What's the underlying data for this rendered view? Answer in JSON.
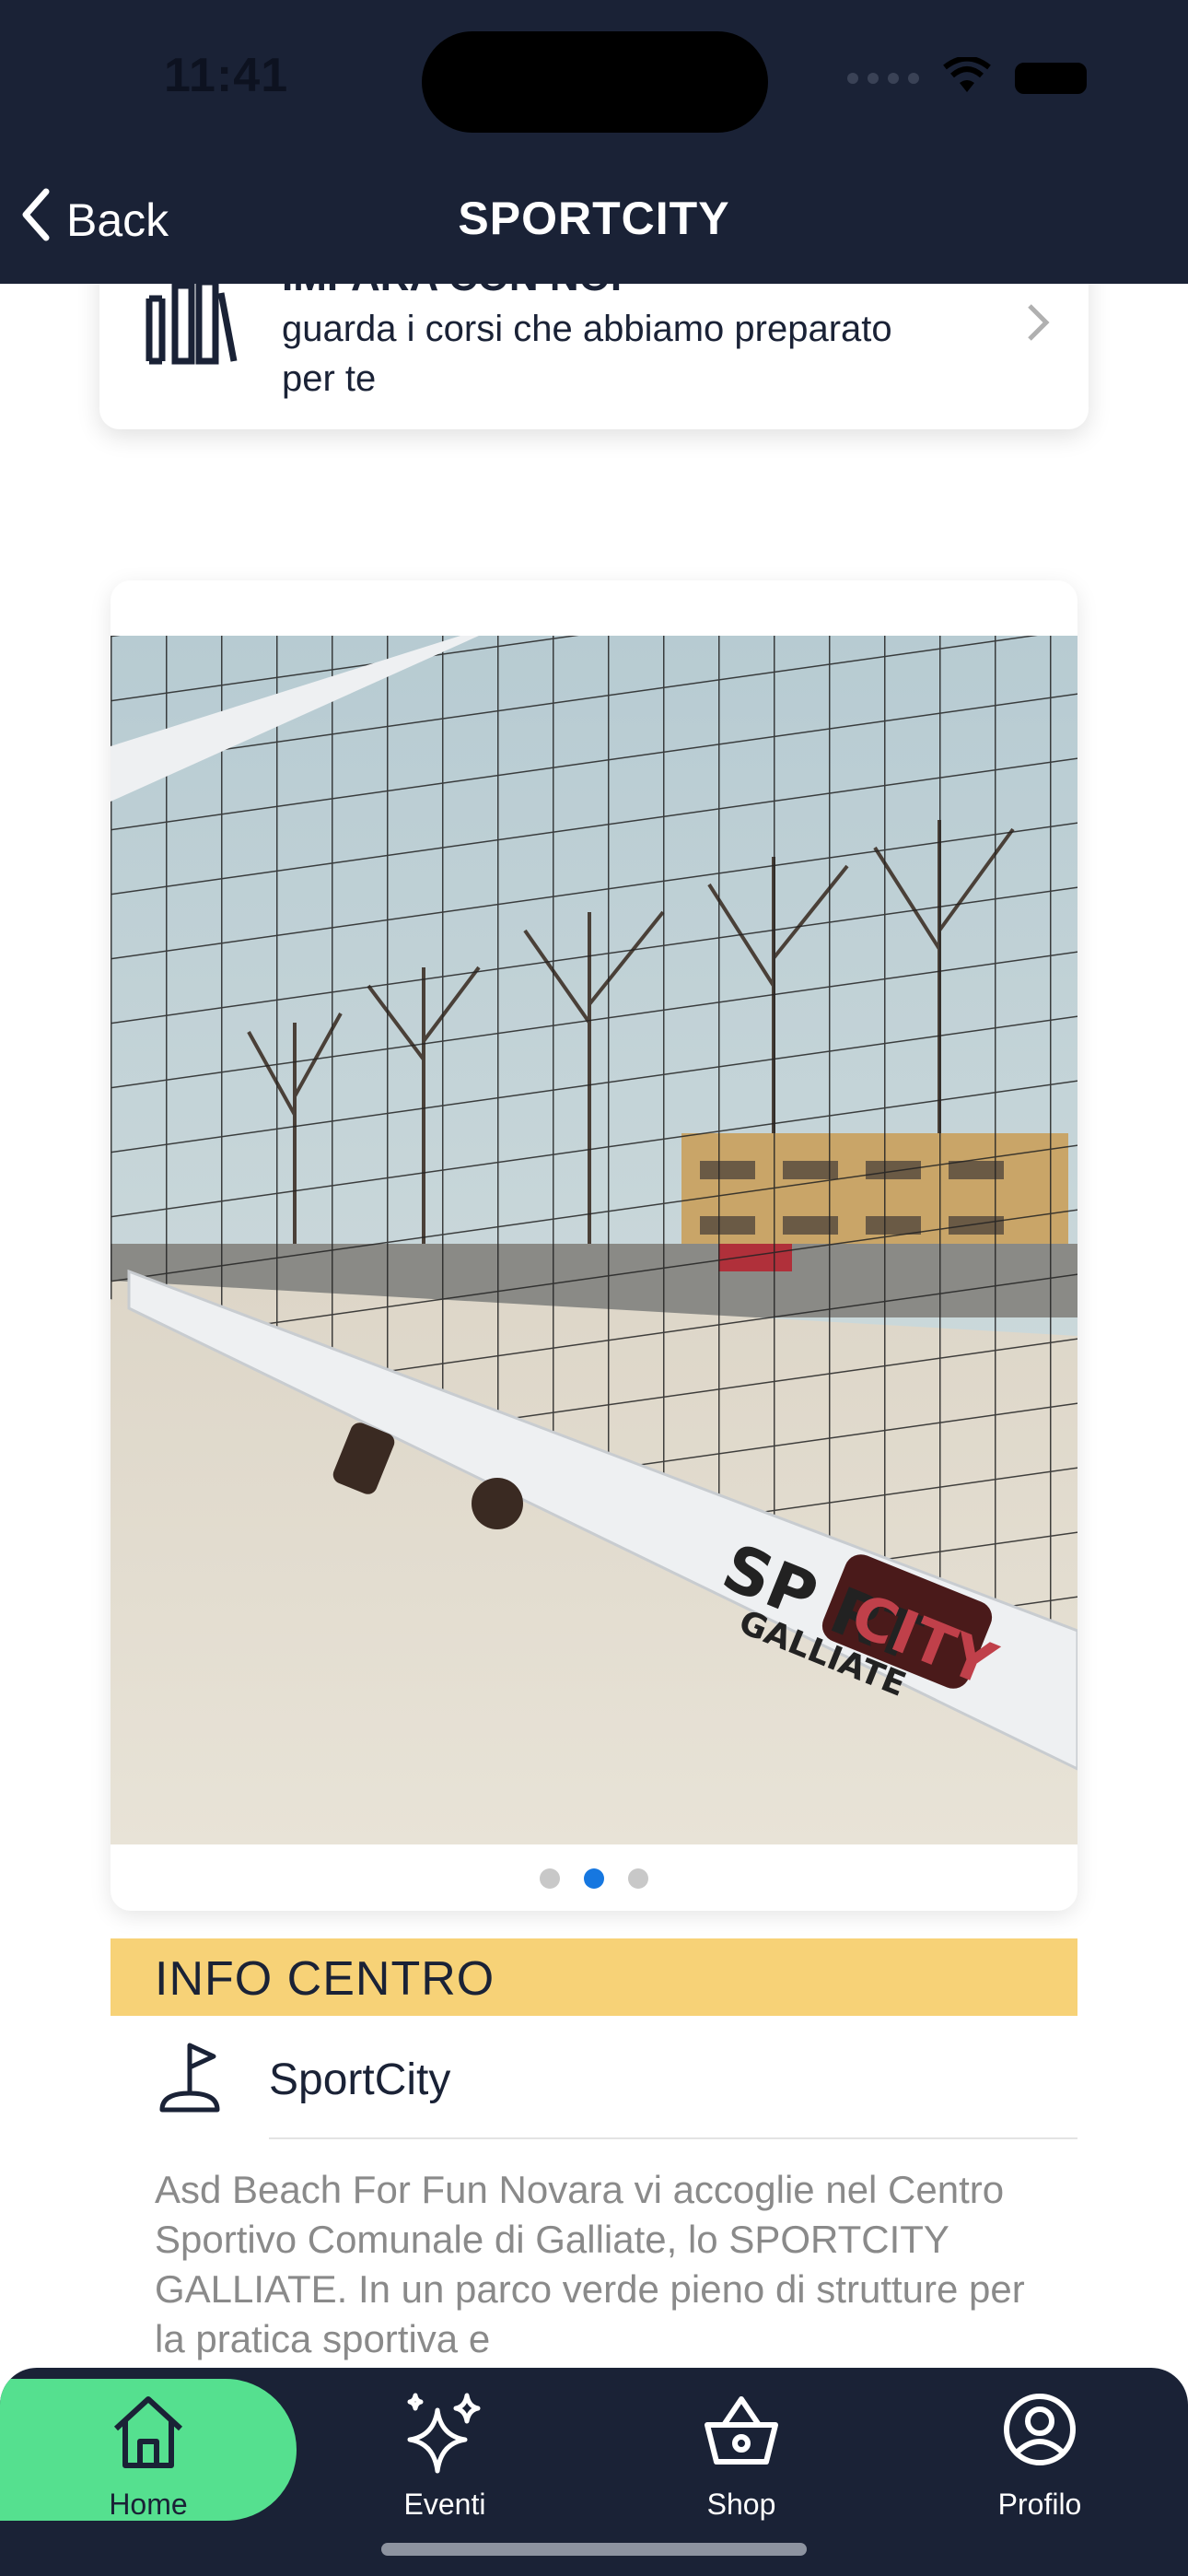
{
  "status_bar": {
    "time": "11:41"
  },
  "nav": {
    "back_label": "Back",
    "title": "SPORTCITY"
  },
  "courses_card": {
    "title": "IMPARA CON NOI",
    "subtitle": "guarda i corsi che abbiamo preparato per te"
  },
  "gallery": {
    "pages": 3,
    "active_page": 2
  },
  "info_section": {
    "header": "INFO CENTRO",
    "center_name": "SportCity",
    "description": "Asd Beach For Fun Novara vi accoglie nel Centro Sportivo Comunale di Galliate, lo SPORTCITY GALLIATE. In un parco verde pieno di strutture per la pratica sportiva e"
  },
  "tabbar": {
    "items": [
      {
        "label": "Home",
        "icon": "home-icon",
        "active": true
      },
      {
        "label": "Eventi",
        "icon": "sparkles-icon",
        "active": false
      },
      {
        "label": "Shop",
        "icon": "basket-icon",
        "active": false
      },
      {
        "label": "Profilo",
        "icon": "profile-icon",
        "active": false
      }
    ]
  },
  "colors": {
    "header_bg": "#1a2236",
    "info_bar": "#f7d277",
    "active_tab": "#55e08f",
    "pager_active": "#1677e0"
  }
}
